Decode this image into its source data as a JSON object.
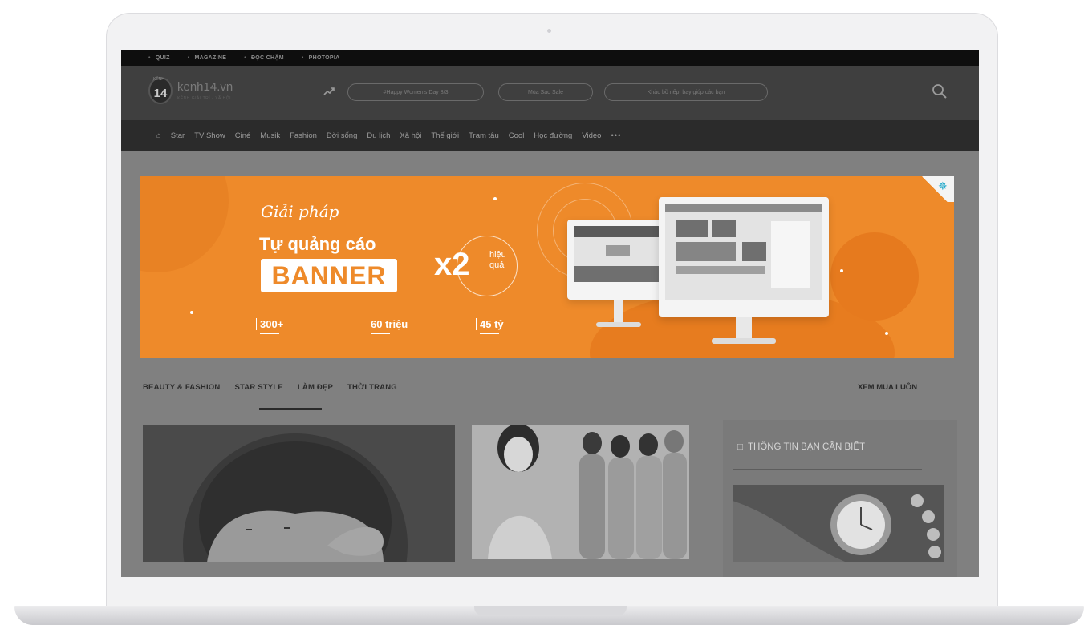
{
  "topbar": {
    "links": [
      "QUIZ",
      "MAGAZINE",
      "ĐỌC CHẬM",
      "PHOTOPIA"
    ]
  },
  "header": {
    "logo_number": "14",
    "logo_small": "KÊNH",
    "site_name": "kenh14.vn",
    "site_sub": "KÊNH GIẢI TRÍ - XÃ HỘI",
    "trending": [
      "#Happy Women's Day 8/3",
      "Mùa Sao Sale",
      "Khảo bồ nếp, bay giúp các bạn"
    ]
  },
  "nav": {
    "items": [
      "Star",
      "TV Show",
      "Ciné",
      "Musik",
      "Fashion",
      "Đời sống",
      "Du lịch",
      "Xã hội",
      "Thế giới",
      "Tram tâu",
      "Cool",
      "Học đường",
      "Video"
    ]
  },
  "banner": {
    "script": "Giải pháp",
    "headline": "Tự quảng cáo",
    "box": "BANNER",
    "multiplier": "x2",
    "multiplier_note": "hiệu quả",
    "stats": [
      "300+",
      "60 triệu",
      "45 tỷ"
    ],
    "colors": {
      "background": "#ee8a2a",
      "text": "#ffffff"
    }
  },
  "section": {
    "tabs": [
      "BEAUTY & FASHION",
      "STAR STYLE",
      "LÀM ĐẸP",
      "THỜI TRANG"
    ],
    "active_tab": "STAR STYLE",
    "see_more": "XEM MUA LUÔN"
  },
  "sidebar": {
    "title": "THÔNG TIN BẠN CẦN BIẾT"
  }
}
